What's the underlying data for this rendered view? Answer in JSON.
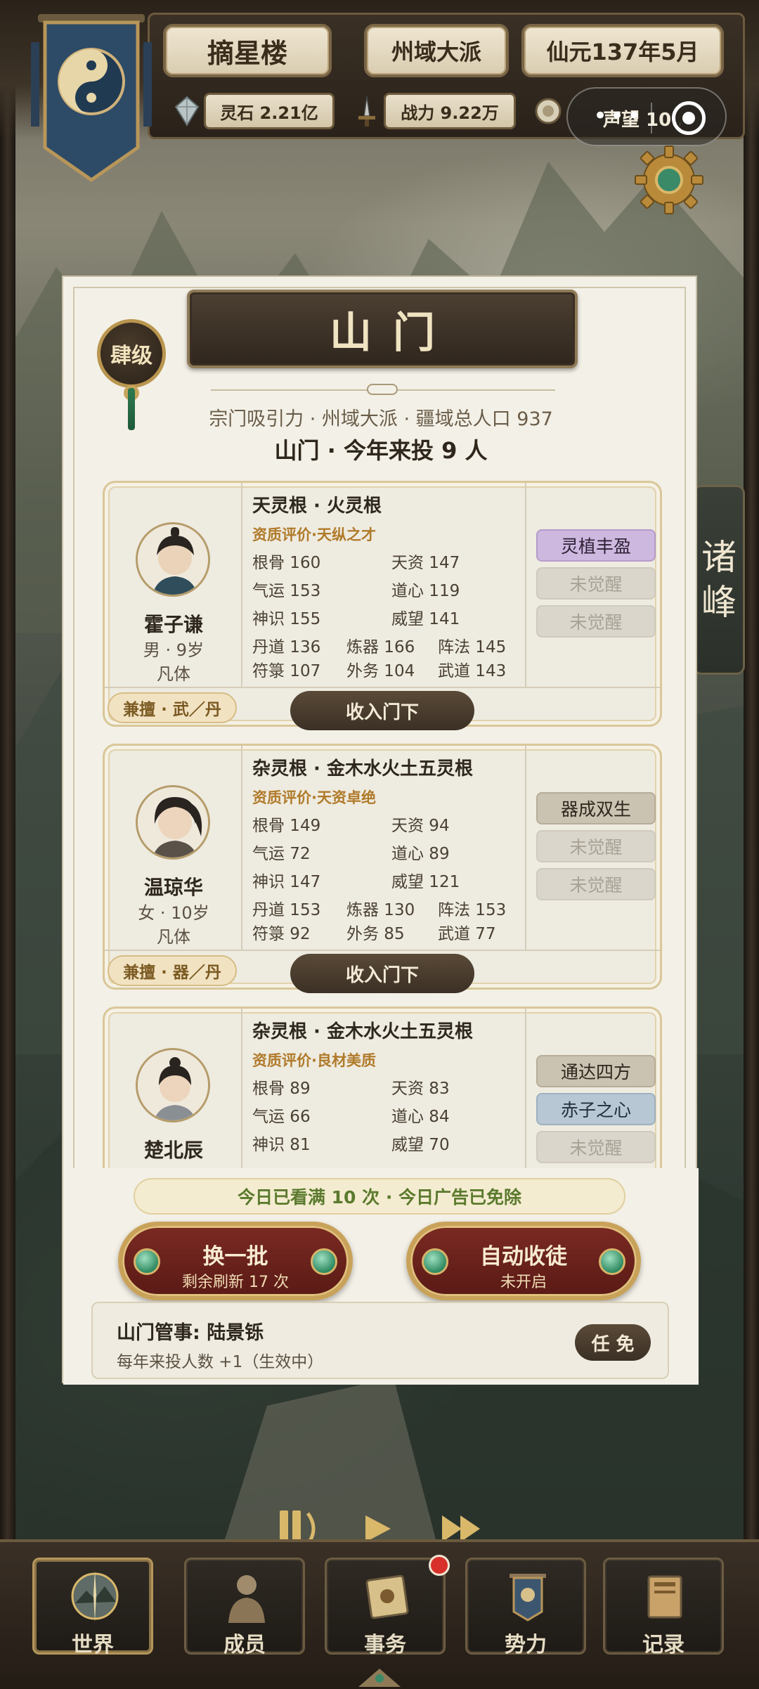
{
  "header": {
    "sect_name": "摘星楼",
    "sect_rank": "州域大派",
    "date": "仙元137年5月",
    "spirit_stones": "灵石 2.21亿",
    "power": "战力 9.22万",
    "reputation": "声望 10..."
  },
  "side_tab": {
    "label_1": "诸",
    "label_2": "峰"
  },
  "modal": {
    "title": "山门",
    "rank_badge": "肆级",
    "summary_line": "宗门吸引力 · 州域大派 · 疆域总人口 937",
    "count_line": "山门 · 今年来投 9 人"
  },
  "candidates": [
    {
      "name": "霍子谦",
      "gender_age": "男 · 9岁",
      "body": "凡体",
      "root": "天灵根 · 火灵根",
      "aptitude": "资质评价·天纵之才",
      "stats": {
        "gengu": "根骨 160",
        "tianzi": "天资 147",
        "qiyun": "气运 153",
        "daoxin": "道心 119",
        "shenshi": "神识 155",
        "weiwang": "威望 141",
        "dandao": "丹道 136",
        "lianqi": "炼器 166",
        "zhenfa": "阵法 145",
        "fulu": "符箓 107",
        "waiwu": "外务 104",
        "wudao": "武道 143"
      },
      "traits": [
        "灵植丰盈",
        "未觉醒",
        "未觉醒"
      ],
      "specialty": "兼擅 · 武／丹",
      "action": "收入门下"
    },
    {
      "name": "温琼华",
      "gender_age": "女 · 10岁",
      "body": "凡体",
      "root": "杂灵根 · 金木水火土五灵根",
      "aptitude": "资质评价·天资卓绝",
      "stats": {
        "gengu": "根骨 149",
        "tianzi": "天资 94",
        "qiyun": "气运 72",
        "daoxin": "道心 89",
        "shenshi": "神识 147",
        "weiwang": "威望 121",
        "dandao": "丹道 153",
        "lianqi": "炼器 130",
        "zhenfa": "阵法 153",
        "fulu": "符箓 92",
        "waiwu": "外务 85",
        "wudao": "武道 77"
      },
      "traits": [
        "器成双生",
        "未觉醒",
        "未觉醒"
      ],
      "specialty": "兼擅 · 器／丹",
      "action": "收入门下"
    },
    {
      "name": "楚北辰",
      "root": "杂灵根 · 金木水火土五灵根",
      "aptitude": "资质评价·良材美质",
      "stats": {
        "gengu": "根骨 89",
        "tianzi": "天资 83",
        "qiyun": "气运 66",
        "daoxin": "道心 84",
        "shenshi": "神识 81",
        "weiwang": "威望 70"
      },
      "traits": [
        "通达四方",
        "赤子之心",
        "未觉醒"
      ]
    }
  ],
  "notice": "今日已看满 10 次 · 今日广告已免除",
  "buttons": {
    "refresh": {
      "label": "换一批",
      "sub": "剩余刷新 17 次"
    },
    "auto": {
      "label": "自动收徒",
      "sub": "未开启"
    }
  },
  "steward": {
    "title": "山门管事:  陆景铄",
    "effect": "每年来投人数 +1（生效中）",
    "dismiss": "任 免"
  },
  "nav": [
    "世界",
    "成员",
    "事务",
    "势力",
    "记录"
  ],
  "colors": {
    "accent_gold": "#c9a25a",
    "button_dark": "#3b3025",
    "button_red": "#7a2a22",
    "trait_purple": "#cdb8df",
    "trait_blue": "#b8c7d4",
    "aptitude_orange": "#b07a2a",
    "notice_green": "#5b7a2e",
    "badge_red": "#d8302a"
  }
}
